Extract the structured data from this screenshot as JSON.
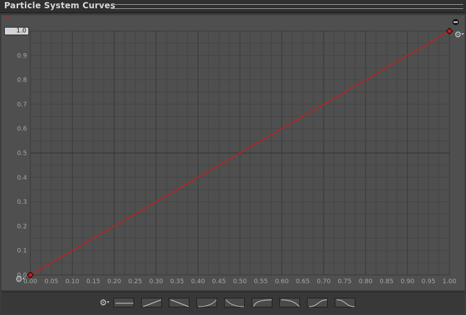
{
  "window": {
    "title": "Particle System Curves"
  },
  "curve": {
    "value_field": "1.0",
    "color": "#c81e1e",
    "grid_color": "#454545",
    "axis_major_color": "#3a3a3a",
    "x_ticks": [
      "0.00",
      "0.05",
      "0.10",
      "0.15",
      "0.20",
      "0.25",
      "0.30",
      "0.35",
      "0.40",
      "0.45",
      "0.50",
      "0.55",
      "0.60",
      "0.65",
      "0.70",
      "0.75",
      "0.80",
      "0.85",
      "0.90",
      "0.95",
      "1.00"
    ],
    "y_ticks": [
      "0.9",
      "0.8",
      "0.7",
      "0.6",
      "0.5",
      "0.4",
      "0.3",
      "0.2",
      "0.1",
      "0.0"
    ],
    "keys": [
      {
        "time": 0.0,
        "value": 0.0
      },
      {
        "time": 1.0,
        "value": 1.0
      }
    ]
  },
  "icons": {
    "minus": "minus-circle-icon",
    "gear": "gear-dropdown-icon"
  },
  "presets": {
    "count": 9,
    "items": [
      "constant",
      "linear-up",
      "linear-down",
      "ease-in",
      "ease-out-down",
      "ease-out",
      "ease-in-down",
      "ease-in-out",
      "ease-in-out-down"
    ]
  }
}
